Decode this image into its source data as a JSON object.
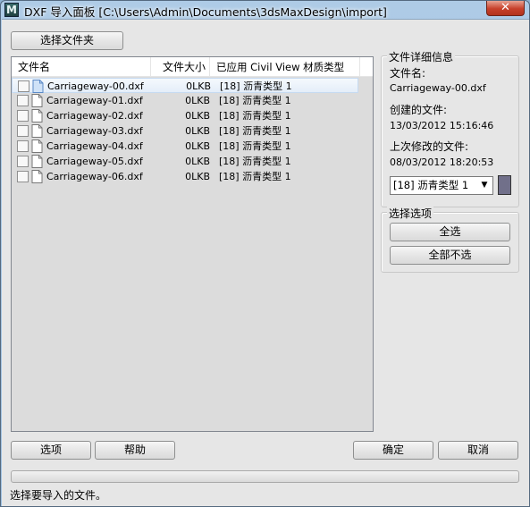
{
  "window": {
    "title": "DXF 导入面板 [C:\\Users\\Admin\\Documents\\3dsMaxDesign\\import]",
    "app_icon_letter": "M",
    "close_symbol": "✕"
  },
  "buttons": {
    "select_folder": "选择文件夹",
    "options": "选项",
    "help": "帮助",
    "ok": "确定",
    "cancel": "取消"
  },
  "file_list": {
    "columns": [
      "文件名",
      "文件大小",
      "已应用 Civil View 材质类型"
    ],
    "rows": [
      {
        "name": "Carriageway-00.dxf",
        "size": "0LKB",
        "material": "[18] 沥青类型 1",
        "selected": true
      },
      {
        "name": "Carriageway-01.dxf",
        "size": "0LKB",
        "material": "[18] 沥青类型 1",
        "selected": false
      },
      {
        "name": "Carriageway-02.dxf",
        "size": "0LKB",
        "material": "[18] 沥青类型 1",
        "selected": false
      },
      {
        "name": "Carriageway-03.dxf",
        "size": "0LKB",
        "material": "[18] 沥青类型 1",
        "selected": false
      },
      {
        "name": "Carriageway-04.dxf",
        "size": "0LKB",
        "material": "[18] 沥青类型 1",
        "selected": false
      },
      {
        "name": "Carriageway-05.dxf",
        "size": "0LKB",
        "material": "[18] 沥青类型 1",
        "selected": false
      },
      {
        "name": "Carriageway-06.dxf",
        "size": "0LKB",
        "material": "[18] 沥青类型 1",
        "selected": false
      }
    ]
  },
  "file_details": {
    "group_title": "文件详细信息",
    "filename_label": "文件名:",
    "filename_value": "Carriageway-00.dxf",
    "created_label": "创建的文件:",
    "created_value": "13/03/2012 15:16:46",
    "modified_label": "上次修改的文件:",
    "modified_value": "08/03/2012 18:20:53",
    "material_select": "[18] 沥青类型 1",
    "swatch_color": "#71708a"
  },
  "selection_options": {
    "group_title": "选择选项",
    "select_all": "全选",
    "select_none": "全部不选"
  },
  "status": {
    "text": "选择要导入的文件。",
    "progress": 0
  }
}
